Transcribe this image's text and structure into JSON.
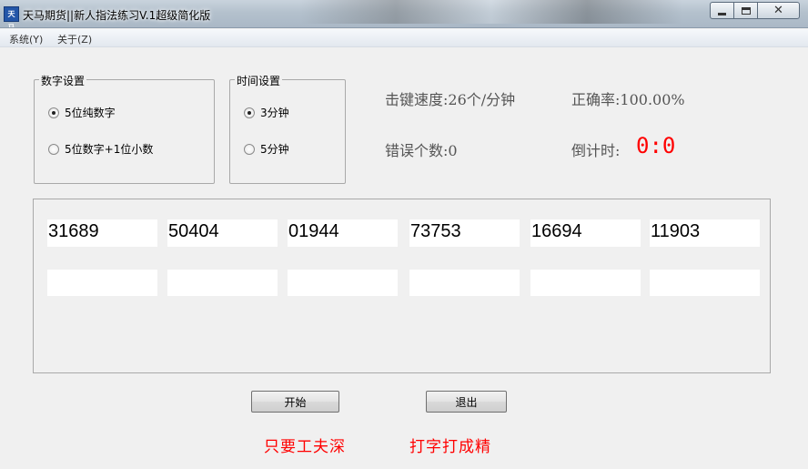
{
  "window": {
    "title": "天马期货||新人指法练习V.1超级简化版",
    "icon_name": "app-icon",
    "icon_text": "天马"
  },
  "menu": [
    {
      "label": "系统(Y)"
    },
    {
      "label": "关于(Z)"
    }
  ],
  "digit_settings": {
    "title": "数字设置",
    "options": [
      {
        "label": "5位纯数字",
        "checked": true
      },
      {
        "label": "5位数字+1位小数",
        "checked": false
      }
    ]
  },
  "time_settings": {
    "title": "时间设置",
    "options": [
      {
        "label": "3分钟",
        "checked": true
      },
      {
        "label": "5分钟",
        "checked": false
      }
    ]
  },
  "stats": {
    "speed_label": "击键速度:",
    "speed_value": "26个/分钟",
    "accuracy_label": "正确率:",
    "accuracy_value": "100.00%",
    "errors_label": "错误个数:",
    "errors_value": "0",
    "countdown_label": "倒计时:",
    "countdown_value": "0:0"
  },
  "practice": {
    "numbers": [
      "31689",
      "50404",
      "01944",
      "73753",
      "16694",
      "11903"
    ],
    "inputs": [
      "",
      "",
      "",
      "",
      "",
      ""
    ]
  },
  "buttons": {
    "start": "开始",
    "exit": "退出"
  },
  "slogans": [
    "只要工夫深",
    "打字打成精"
  ],
  "colors": {
    "countdown": "#ff0000",
    "slogan": "#ff0000",
    "stat_text": "#555555"
  }
}
